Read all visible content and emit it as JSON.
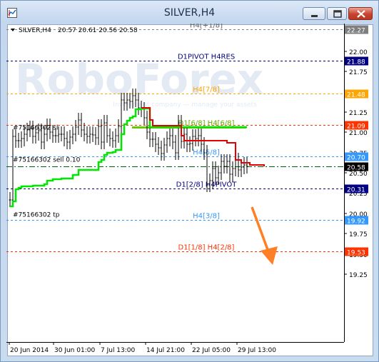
{
  "window": {
    "title": "SILVER,H4",
    "buttons": [
      "minimize",
      "maximize",
      "close"
    ]
  },
  "chart_header": {
    "symbol": "SILVER,H4",
    "quote": "20.57 20.61 20.56 20.58"
  },
  "watermark": "RoboForex",
  "watermark_sub": "Investment company — manage your assets",
  "colors": {
    "green_line": "#00e600",
    "red_line": "#e60000",
    "candles": "#000000",
    "arrow": "#ff7f27"
  },
  "levels": [
    {
      "label": "H4[+1/8]",
      "price": 22.27,
      "tag": "22.27",
      "color": "#808080",
      "label_color": "#606060",
      "style": "dash",
      "tag_bg": "#7f7f7f"
    },
    {
      "label": "D1PIVOT H4RES",
      "price": 21.88,
      "tag": "21.88",
      "color": "#000080",
      "label_color": "#000080",
      "style": "dash",
      "tag_bg": "#000080"
    },
    {
      "label": "H4[7/8]",
      "price": 21.48,
      "tag": "21.48",
      "color": "#ffa500",
      "label_color": "#ffa500",
      "style": "dash",
      "tag_bg": "#ffa500"
    },
    {
      "label": "",
      "price": 21.09,
      "tag": "21.09",
      "color": "#ff3300",
      "label_color": "#ff3300",
      "style": "dash",
      "tag_bg": "#ff3300"
    },
    {
      "label": "D1[6/8] H4[6/8]",
      "price": 21.06,
      "tag": "",
      "color": "#66cc00",
      "label_color": "#66aa00",
      "style": "solid",
      "tag_bg": ""
    },
    {
      "label": "H4[5/8]",
      "price": 20.7,
      "tag": "20.70",
      "color": "#3399ff",
      "label_color": "#3399ff",
      "style": "dash",
      "tag_bg": "#3399ff"
    },
    {
      "label": "",
      "price": 20.58,
      "tag": "20.58",
      "color": "#006400",
      "label_color": "#006400",
      "style": "dashdot",
      "tag_bg": "#000000"
    },
    {
      "label": "D1[2/8] H4PIVOT",
      "price": 20.31,
      "tag": "20.31",
      "color": "#000080",
      "label_color": "#000080",
      "style": "dash",
      "tag_bg": "#000080"
    },
    {
      "label": "H4[3/8]",
      "price": 19.92,
      "tag": "19.92",
      "color": "#3399ff",
      "label_color": "#3399ff",
      "style": "dash",
      "tag_bg": "#3399ff"
    },
    {
      "label": "D1[1/8] H4[2/8]",
      "price": 19.53,
      "tag": "19.53",
      "color": "#ff3300",
      "label_color": "#ff3300",
      "style": "dash",
      "tag_bg": "#ff3300"
    }
  ],
  "order_lines": [
    {
      "label": "#75166302 sl",
      "price": 21.02,
      "color": "#ff0000"
    },
    {
      "label": "#75166302 sell 0.10",
      "price": 20.62,
      "color": "#006400"
    },
    {
      "label": "#75166302 tp",
      "price": 19.95,
      "color": "#ff0000"
    }
  ],
  "price_axis": [
    "22.00",
    "21.75",
    "21.50",
    "21.25",
    "21.00",
    "20.75",
    "20.50",
    "20.25",
    "20.00",
    "19.75",
    "19.50",
    "19.25"
  ],
  "price_axis_values": [
    22.0,
    21.75,
    21.5,
    21.25,
    21.0,
    20.75,
    20.5,
    20.25,
    20.0,
    19.75,
    19.5,
    19.25
  ],
  "time_axis": [
    "20 Jun 2014",
    "30 Jun 01:00",
    "7 Jul 13:00",
    "14 Jul 21:00",
    "22 Jul 05:00",
    "29 Jul 13:00"
  ],
  "chart_data": {
    "type": "line",
    "series": [
      {
        "values": [
          20.17,
          20.95,
          20.9,
          20.9,
          20.92,
          20.98,
          21.03,
          21.05,
          20.95,
          20.99,
          21.02,
          20.88,
          20.98,
          21.08,
          21.0,
          20.96,
          20.96,
          20.98,
          20.98,
          20.92,
          20.88,
          20.94,
          20.98,
          21.06,
          21.15,
          21.03,
          20.98,
          20.95,
          20.98,
          20.97,
          20.93,
          21.07,
          20.88,
          21.12,
          20.96,
          20.92,
          20.9,
          20.96,
          21.07,
          21.4,
          21.36,
          21.4,
          21.38,
          21.45,
          21.4,
          21.3,
          21.28,
          21.18,
          21.0,
          20.91,
          20.91,
          20.85,
          20.81,
          20.74,
          20.84,
          20.92,
          20.96,
          20.88,
          20.75,
          21.12,
          20.89,
          20.98,
          20.85,
          20.86,
          20.95,
          20.92,
          20.96,
          20.85,
          20.75,
          20.35,
          20.4,
          20.55,
          20.44,
          20.5,
          20.64,
          20.58,
          20.64,
          20.48,
          20.55,
          20.66,
          20.54,
          20.57,
          20.6,
          20.58
        ]
      }
    ],
    "green_line": [
      20.09,
      20.15,
      20.3,
      20.32,
      20.33,
      20.33,
      20.33,
      20.33,
      20.34,
      20.34,
      20.34,
      20.34,
      20.36,
      20.4,
      20.4,
      20.42,
      20.42,
      20.42,
      20.43,
      20.43,
      20.43,
      20.43,
      20.47,
      20.47,
      20.54,
      20.54,
      20.54,
      20.54,
      20.54,
      20.54,
      20.54,
      20.63,
      20.66,
      20.72,
      20.75,
      20.75,
      20.76,
      20.78,
      20.78,
      20.98,
      21.1,
      21.14,
      21.18,
      21.2,
      21.28,
      21.28,
      21.29,
      21.29,
      21.29,
      21.06,
      21.06,
      21.06,
      21.06,
      21.06,
      21.06,
      21.06,
      21.06,
      21.06,
      21.06,
      21.06,
      21.06,
      21.06,
      21.06,
      21.06,
      21.06,
      21.06,
      21.06,
      21.06,
      21.06,
      21.06,
      21.06,
      21.06,
      21.06,
      21.06,
      21.06,
      21.06,
      21.06,
      21.06,
      21.06,
      21.06,
      21.06,
      21.06,
      21.06,
      21.06
    ],
    "red_line": [
      21.3,
      21.3,
      21.3,
      21.15,
      21.08,
      21.08,
      21.08,
      21.08,
      21.08,
      21.08,
      21.08,
      21.08,
      21.08,
      21.08,
      20.96,
      20.9,
      20.9,
      20.9,
      20.9,
      20.9,
      20.9,
      20.9,
      20.9,
      20.9,
      20.9,
      20.9,
      20.9,
      20.9,
      20.9,
      20.9,
      20.87,
      20.87,
      20.87,
      20.66,
      20.66,
      20.62,
      20.62,
      20.62,
      20.6,
      20.6,
      20.6,
      20.6,
      20.6,
      20.58
    ],
    "ylim": [
      19.12,
      22.35
    ],
    "xlabel": "",
    "ylabel": ""
  }
}
